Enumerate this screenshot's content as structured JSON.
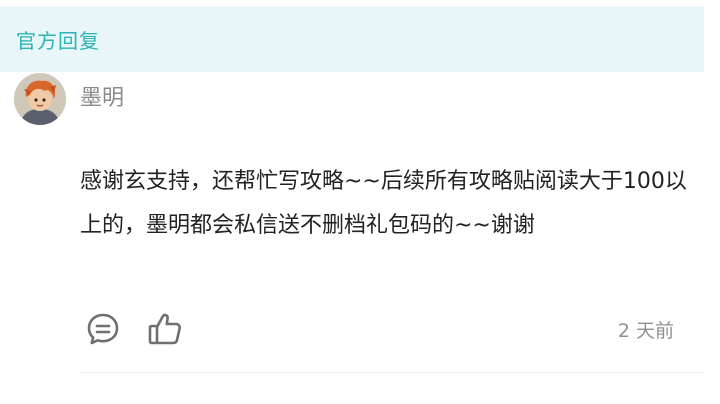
{
  "official_reply": {
    "label": "官方回复"
  },
  "reply": {
    "username": "墨明",
    "text": "感谢玄支持，还帮忙写攻略~~后续所有攻略贴阅读大于100以上的，墨明都会私信送不删档礼包码的~~谢谢",
    "time": "2 天前",
    "icons": {
      "comment": "comment-bubble-icon",
      "like": "thumbs-up-icon"
    }
  },
  "colors": {
    "accent": "#2bb3b6",
    "banner_bg": "#e8f6f7",
    "text": "#222222",
    "muted": "#8a8a8a"
  }
}
